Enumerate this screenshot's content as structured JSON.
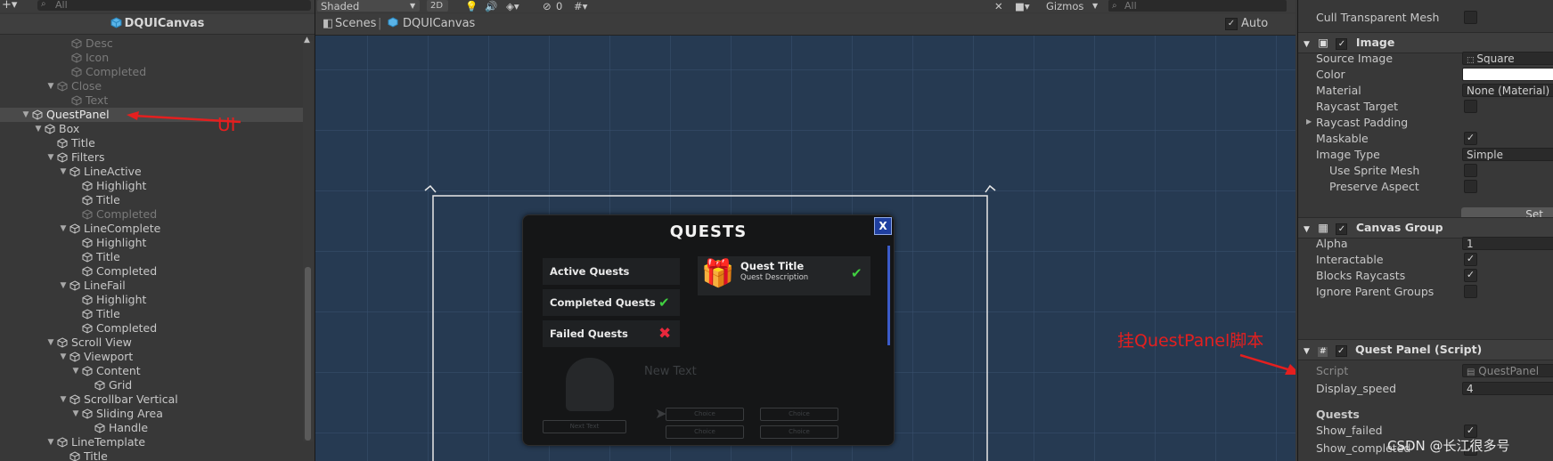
{
  "hierarchy": {
    "search_placeholder": "All",
    "title": "DQUICanvas",
    "rows": [
      {
        "label": "Desc",
        "dim": true
      },
      {
        "label": "Icon",
        "dim": true
      },
      {
        "label": "Completed",
        "dim": true
      },
      {
        "label": "Close",
        "dim": true
      },
      {
        "label": "Text",
        "dim": true
      },
      {
        "label": "QuestPanel",
        "selected": true
      },
      {
        "label": "Box"
      },
      {
        "label": "Title"
      },
      {
        "label": "Filters"
      },
      {
        "label": "LineActive"
      },
      {
        "label": "Highlight"
      },
      {
        "label": "Title"
      },
      {
        "label": "Completed",
        "dim": true
      },
      {
        "label": "LineComplete"
      },
      {
        "label": "Highlight"
      },
      {
        "label": "Title"
      },
      {
        "label": "Completed"
      },
      {
        "label": "LineFail"
      },
      {
        "label": "Highlight"
      },
      {
        "label": "Title"
      },
      {
        "label": "Completed"
      },
      {
        "label": "Scroll View"
      },
      {
        "label": "Viewport"
      },
      {
        "label": "Content"
      },
      {
        "label": "Grid"
      },
      {
        "label": "Scrollbar Vertical"
      },
      {
        "label": "Sliding Area"
      },
      {
        "label": "Handle"
      },
      {
        "label": "LineTemplate"
      },
      {
        "label": "Title"
      }
    ]
  },
  "scene_toolbar": {
    "shading": "Shaded",
    "mode_2d": "2D",
    "hidden_count": "0",
    "gizmos": "Gizmos",
    "search_placeholder": "All"
  },
  "scene_tabs": {
    "scenes": "Scenes",
    "canvas": "DQUICanvas",
    "auto_save": "Auto Save"
  },
  "game_panel": {
    "title": "QUESTS",
    "close": "X",
    "filters": [
      "Active Quests",
      "Completed Quests",
      "Failed Quests"
    ],
    "quest_title": "Quest Title",
    "quest_description": "Quest Description",
    "bg_text": "New Text",
    "choice": "Choice",
    "next_text": "Next Text"
  },
  "annotations": {
    "ui": "UI",
    "script": "挂QuestPanel脚本"
  },
  "inspector": {
    "cull_label": "Cull Transparent Mesh",
    "image": {
      "header": "Image",
      "fields": [
        {
          "label": "Source Image",
          "value": "Square"
        },
        {
          "label": "Color",
          "value": ""
        },
        {
          "label": "Material",
          "value": "None (Material)"
        },
        {
          "label": "Raycast Target",
          "check": false
        },
        {
          "label": "Raycast Padding",
          "foldout": true
        },
        {
          "label": "Maskable",
          "check": true
        },
        {
          "label": "Image Type",
          "value": "Simple"
        },
        {
          "label": "Use Sprite Mesh",
          "check": false,
          "indent": true
        },
        {
          "label": "Preserve Aspect",
          "check": false,
          "indent": true
        }
      ],
      "set_button": "Set"
    },
    "canvas_group": {
      "header": "Canvas Group",
      "fields": [
        {
          "label": "Alpha",
          "value": "1"
        },
        {
          "label": "Interactable",
          "check": true
        },
        {
          "label": "Blocks Raycasts",
          "check": true
        },
        {
          "label": "Ignore Parent Groups",
          "check": false
        }
      ]
    },
    "quest_panel": {
      "header": "Quest Panel (Script)",
      "script_label": "Script",
      "script_value": "QuestPanel",
      "display_speed_label": "Display_speed",
      "display_speed_value": "4",
      "section": "Quests",
      "show_failed": "Show_failed",
      "show_completed": "Show_completed"
    }
  },
  "watermark": "CSDN @长江很多号",
  "colors": {
    "annotation_red": "#e41f1f",
    "selected_row": "#4a4a4a",
    "scene_bg": "#263a52"
  }
}
